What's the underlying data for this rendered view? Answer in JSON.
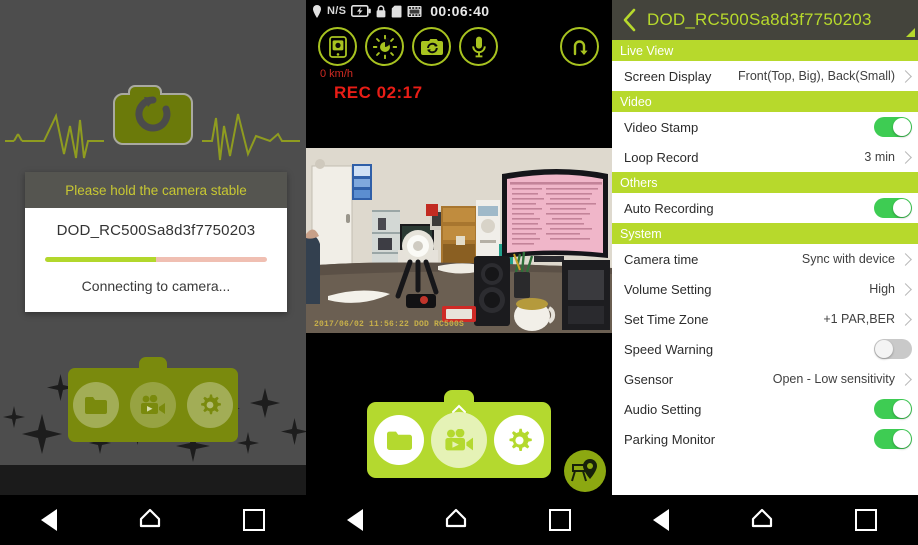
{
  "panel1": {
    "name": "connecting-splash",
    "dialog": {
      "header": "Please hold the camera stable",
      "device": "DOD_RC500Sa8d3f7750203",
      "status": "Connecting to camera...",
      "progress_percent": 50,
      "progress_fill_color": "#b2d72c",
      "progress_track_color": "#f0bfb2"
    },
    "logo": {
      "icon": "camera-refresh-icon",
      "color": "#6b7a0a"
    },
    "quick_dock": {
      "items": [
        {
          "icon": "folder-icon",
          "label": "Files"
        },
        {
          "icon": "video-camera-icon",
          "label": "Live View"
        },
        {
          "icon": "gear-icon",
          "label": "Settings"
        }
      ]
    },
    "navbar": {
      "back": "back-icon",
      "home": "home-icon",
      "recents": "recents-icon"
    }
  },
  "panel2": {
    "name": "live-view",
    "status_bar": {
      "gps": "N/S",
      "icons": [
        "location-pin-icon",
        "battery-charging-icon",
        "lock-icon",
        "sd-card-icon",
        "film-icon"
      ],
      "time": "00:06:40"
    },
    "tools": [
      {
        "icon": "phone-snapshot-icon",
        "label": "Snapshot"
      },
      {
        "icon": "brightness-icon",
        "label": "Brightness"
      },
      {
        "icon": "camera-switch-icon",
        "label": "Switch Camera"
      },
      {
        "icon": "microphone-icon",
        "label": "Microphone"
      }
    ],
    "back_button": {
      "icon": "return-arrow-icon"
    },
    "speed": "0 km/h",
    "recording": "REC 02:17",
    "video_stamp": "2017/06/02 11:56:22 DOD RC500S",
    "dock": [
      {
        "icon": "folder-icon",
        "label": "Files"
      },
      {
        "icon": "video-camera-icon",
        "label": "Record"
      },
      {
        "icon": "gear-icon",
        "label": "Settings"
      }
    ],
    "gps_button": {
      "icon": "map-pin-icon"
    },
    "navbar": {
      "back": "back-icon",
      "home": "home-icon",
      "recents": "recents-icon"
    }
  },
  "panel3": {
    "name": "camera-settings",
    "header": {
      "back_icon": "chevron-left-icon",
      "title": "DOD_RC500Sa8d3f7750203"
    },
    "sections": [
      {
        "title": "Live View",
        "rows": [
          {
            "label": "Screen Display",
            "value": "Front(Top, Big), Back(Small)",
            "type": "chevron"
          }
        ]
      },
      {
        "title": "Video",
        "rows": [
          {
            "label": "Video Stamp",
            "value": "",
            "type": "toggle",
            "state": "on"
          },
          {
            "label": "Loop Record",
            "value": "3 min",
            "type": "chevron"
          }
        ]
      },
      {
        "title": "Others",
        "rows": [
          {
            "label": "Auto Recording",
            "value": "",
            "type": "toggle",
            "state": "on"
          }
        ]
      },
      {
        "title": "System",
        "rows": [
          {
            "label": "Camera time",
            "value": "Sync with device",
            "type": "chevron"
          },
          {
            "label": "Volume Setting",
            "value": "High",
            "type": "chevron"
          },
          {
            "label": "Set Time Zone",
            "value": "+1 PAR,BER",
            "type": "chevron"
          },
          {
            "label": "Speed Warning",
            "value": "",
            "type": "toggle",
            "state": "off"
          },
          {
            "label": "Gsensor",
            "value": "Open - Low sensitivity",
            "type": "chevron"
          },
          {
            "label": "Audio Setting",
            "value": "",
            "type": "toggle",
            "state": "on"
          },
          {
            "label": "Parking Monitor",
            "value": "",
            "type": "toggle",
            "state": "on"
          }
        ]
      }
    ],
    "navbar": {
      "back": "back-icon",
      "home": "home-icon",
      "recents": "recents-icon"
    }
  },
  "colors": {
    "brand_green": "#b7d92c",
    "dark_header": "#44443c",
    "toggle_on": "#3ecc53",
    "toggle_off": "#c9c9c9",
    "rec_red": "#e81d16",
    "olive": "#6b7a0a"
  }
}
